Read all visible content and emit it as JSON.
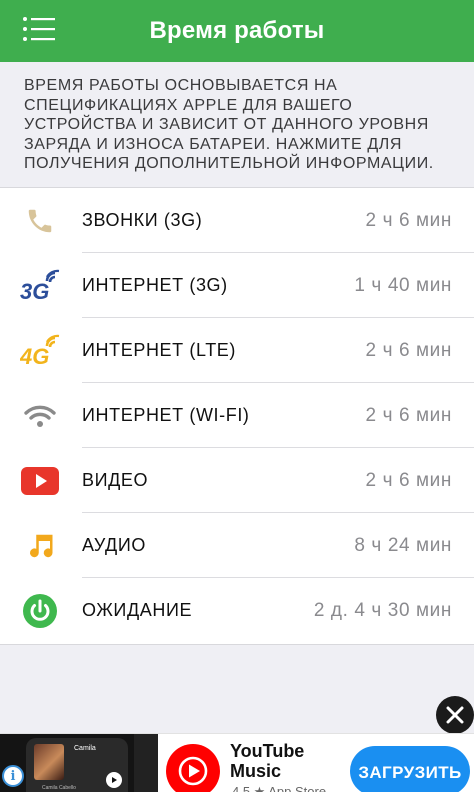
{
  "header": {
    "title": "Время работы",
    "menu_icon": "hamburger-menu-icon",
    "background": "#3fae4e"
  },
  "info": {
    "text": "ВРЕМЯ РАБОТЫ ОСНОВЫВАЕТСЯ НА СПЕЦИФИКАЦИЯХ  APPLE ДЛЯ ВАШЕГО УСТРОЙСТВА И ЗАВИСИТ ОТ ДАННОГО УРОВНЯ ЗАРЯДА И ИЗНОСА БАТАРЕИ. НАЖМИТЕ ДЛЯ ПОЛУЧЕНИЯ ДОПОЛНИТЕЛЬНОЙ ИНФОРМАЦИИ."
  },
  "usage": [
    {
      "label": "ЗВОНКИ (3G)",
      "value": "2 ч 6 мин",
      "icon": "phone-icon",
      "icon_color": "#d8c49a"
    },
    {
      "label": "ИНТЕРНЕТ (3G)",
      "value": "1 ч 40 мин",
      "icon": "3g-signal-icon",
      "icon_color": "#2c4e9a"
    },
    {
      "label": "ИНТЕРНЕТ (LTE)",
      "value": "2 ч 6 мин",
      "icon": "4g-signal-icon",
      "icon_color": "#f2b41c"
    },
    {
      "label": "ИНТЕРНЕТ (WI-FI)",
      "value": "2 ч 6 мин",
      "icon": "wifi-icon",
      "icon_color": "#8a8a8a"
    },
    {
      "label": "ВИДЕО",
      "value": "2 ч 6 мин",
      "icon": "video-play-icon",
      "icon_color": "#e8362b"
    },
    {
      "label": "АУДИО",
      "value": "8 ч 24 мин",
      "icon": "music-note-icon",
      "icon_color": "#f2a81c"
    },
    {
      "label": "ОЖИДАНИЕ",
      "value": "2 д. 4 ч 30 мин",
      "icon": "power-icon",
      "icon_color": "#3fb84e"
    }
  ],
  "ad": {
    "app_name": "YouTube Music",
    "subtitle": "4.5 ★ App Store",
    "cta": "ЗАГРУЗИТЬ",
    "thumb_song": "Camila",
    "thumb_artist": "Camila Cabello",
    "info_icon": "i",
    "cta_color": "#1a8ff1"
  }
}
